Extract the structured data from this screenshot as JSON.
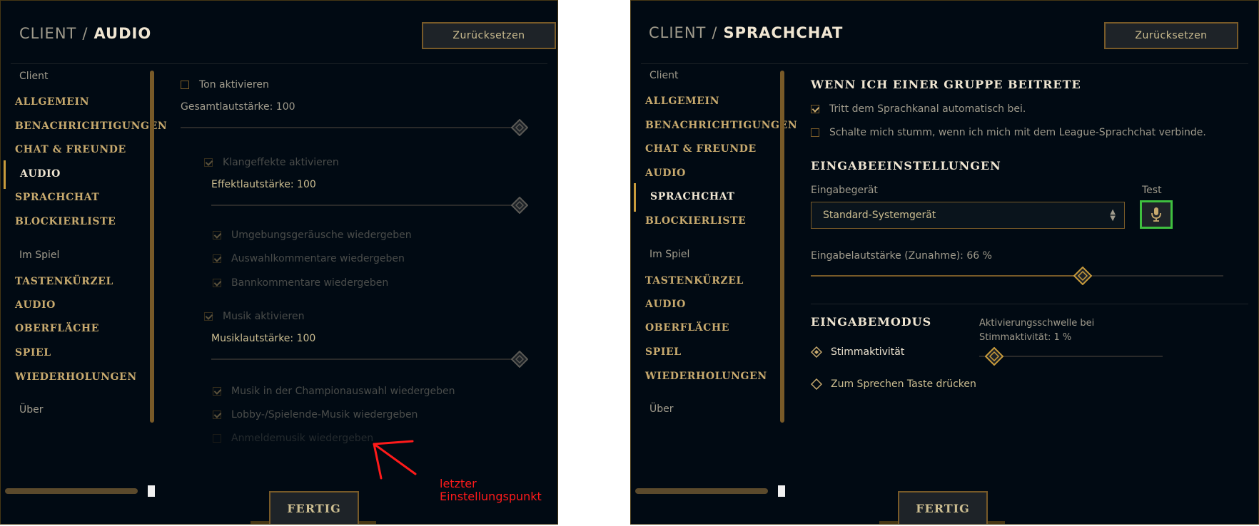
{
  "left": {
    "title_prefix": "CLIENT",
    "title_separator": "/",
    "title_section": "AUDIO",
    "reset_label": "Zurücksetzen",
    "nav": {
      "group_client": "Client",
      "items_client": [
        "ALLGEMEIN",
        "BENACHRICHTIGUNGEN",
        "CHAT & FREUNDE",
        "AUDIO",
        "SPRACHCHAT",
        "BLOCKIERLISTE"
      ],
      "group_ingame": "Im Spiel",
      "items_ingame": [
        "TASTENKÜRZEL",
        "AUDIO",
        "OBERFLÄCHE",
        "SPIEL",
        "WIEDERHOLUNGEN"
      ],
      "group_about": "Über",
      "active": "AUDIO"
    },
    "settings": {
      "ton_aktivieren": "Ton aktivieren",
      "gesamt": "Gesamtlautstärke: 100",
      "klangeffekte": "Klangeffekte aktivieren",
      "effekt": "Effektlautstärke: 100",
      "umgebung": "Umgebungsgeräusche wiedergeben",
      "auswahl": "Auswahlkommentare wiedergeben",
      "bann": "Bannkommentare wiedergeben",
      "musik": "Musik aktivieren",
      "musiklaut": "Musiklautstärke: 100",
      "champion": "Musik in der Championauswahl wiedergeben",
      "lobby": "Lobby-/Spielende-Musik wiedergeben",
      "anmelde": "Anmeldemusik wiedergeben"
    },
    "volumes": {
      "gesamt": 100,
      "effekt": 100,
      "musik": 100
    },
    "done_label": "FERTIG"
  },
  "annotation": {
    "line1": "letzter",
    "line2": "Einstellungspunkt",
    "color": "#ff1a1a"
  },
  "right": {
    "title_prefix": "CLIENT",
    "title_separator": "/",
    "title_section": "SPRACHCHAT",
    "reset_label": "Zurücksetzen",
    "nav": {
      "group_client": "Client",
      "items_client": [
        "ALLGEMEIN",
        "BENACHRICHTIGUNGEN",
        "CHAT & FREUNDE",
        "AUDIO",
        "SPRACHCHAT",
        "BLOCKIERLISTE"
      ],
      "group_ingame": "Im Spiel",
      "items_ingame": [
        "TASTENKÜRZEL",
        "AUDIO",
        "OBERFLÄCHE",
        "SPIEL",
        "WIEDERHOLUNGEN"
      ],
      "group_about": "Über",
      "active": "SPRACHCHAT"
    },
    "group_heading": "WENN ICH EINER GRUPPE BEITRETE",
    "auto_join": "Tritt dem Sprachkanal automatisch bei.",
    "mute_on_connect": "Schalte mich stumm, wenn ich mich mit dem League-Sprachchat verbinde.",
    "input_heading": "EINGABEEINSTELLUNGEN",
    "device_label": "Eingabegerät",
    "device_value": "Standard-Systemgerät",
    "test_label": "Test",
    "input_volume_label": "Eingabelautstärke (Zunahme): 66 %",
    "input_volume": 66,
    "mode_heading": "EINGABEMODUS",
    "mode_voice": "Stimmaktivität",
    "mode_ptt": "Zum Sprechen Taste drücken",
    "threshold_label_1": "Aktivierungsschwelle bei",
    "threshold_label_2": "Stimmaktivität: 1 %",
    "threshold": 1,
    "done_label": "FERTIG"
  },
  "colors": {
    "background": "#010a13",
    "gold": "#c8aa6e",
    "gold_dark": "#785a28",
    "text": "#a09b8c",
    "text_bright": "#f0e6d2",
    "test_highlight": "#3fbf3f"
  }
}
